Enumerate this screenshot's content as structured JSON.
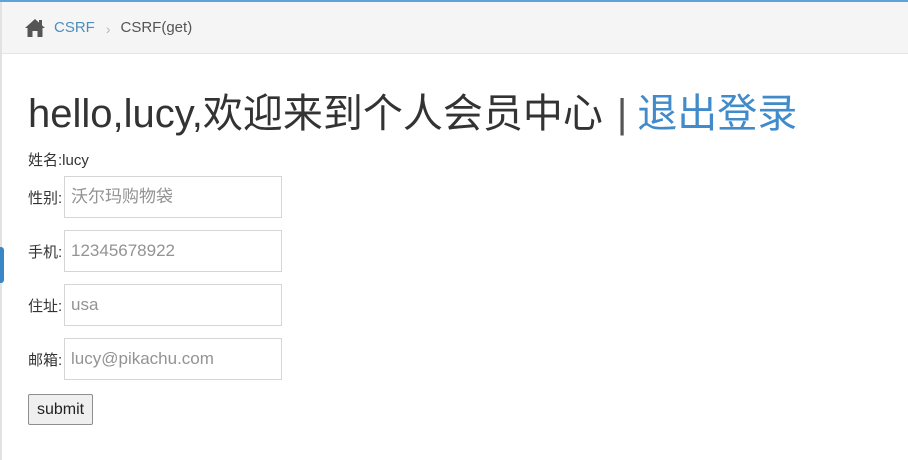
{
  "breadcrumbs": {
    "home_icon": "home-icon",
    "parent": "CSRF",
    "separator": "›",
    "current": "CSRF(get)"
  },
  "profile": {
    "greeting": "hello,lucy,欢迎来到个人会员中心",
    "divider": "|",
    "logout": "退出登录",
    "name_label": "姓名:",
    "name_value": "lucy"
  },
  "form": {
    "fields": [
      {
        "label": "性别:",
        "placeholder": "沃尔玛购物袋"
      },
      {
        "label": "手机:",
        "placeholder": "12345678922"
      },
      {
        "label": "住址:",
        "placeholder": "usa"
      },
      {
        "label": "邮箱:",
        "placeholder": "lucy@pikachu.com"
      }
    ],
    "submit_label": "submit"
  },
  "colors": {
    "link": "#428bca",
    "breadcrumb_link": "#4c8fbd",
    "breadcrumb_bg": "#f5f5f5",
    "top_border": "#5aa4d8"
  }
}
